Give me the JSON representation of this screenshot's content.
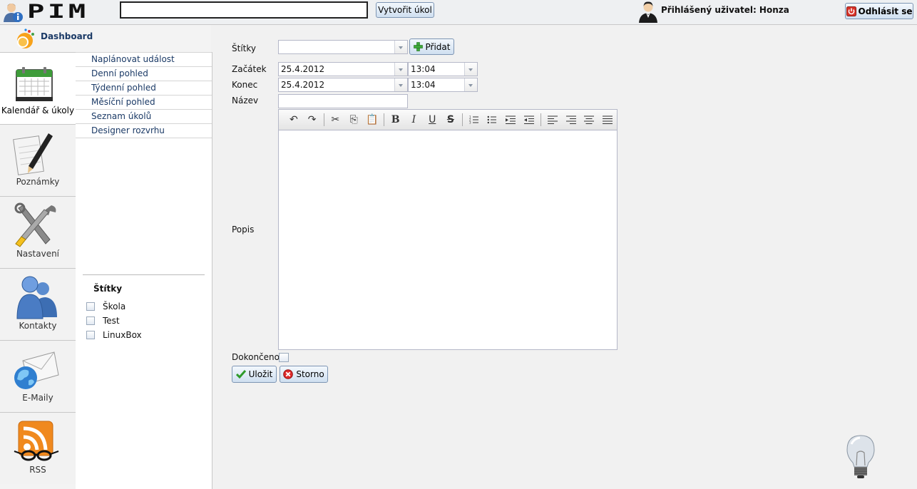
{
  "topbar": {
    "logo_text": "PIM",
    "search": {
      "value": "",
      "placeholder": ""
    },
    "create_task_label": "Vytvořit úkol",
    "user_label": "Přihlášený uživatel: Honza",
    "logout_label": "Odhlásit se"
  },
  "dashboard": {
    "label": "Dashboard"
  },
  "modules": [
    {
      "label": "Kalendář & úkoly",
      "icon": "calendar-icon",
      "active": true
    },
    {
      "label": "Poznámky",
      "icon": "notepad-icon"
    },
    {
      "label": "Nastavení",
      "icon": "tools-icon"
    },
    {
      "label": "Kontakty",
      "icon": "contacts-icon"
    },
    {
      "label": "E-Maily",
      "icon": "email-icon"
    },
    {
      "label": "RSS",
      "icon": "rss-icon"
    }
  ],
  "submenu": {
    "items": [
      "Naplánovat událost",
      "Denní pohled",
      "Týdenní pohled",
      "Měsíční pohled",
      "Seznam úkolů",
      "Designer rozvrhu"
    ],
    "tags_title": "Štítky",
    "tags": [
      "Škola",
      "Test",
      "LinuxBox"
    ]
  },
  "form": {
    "tags_label": "Štítky",
    "tags_value": "",
    "add_label": "Přidat",
    "start_label": "Začátek",
    "start_date": "25.4.2012",
    "start_time": "13:04",
    "end_label": "Konec",
    "end_date": "25.4.2012",
    "end_time": "13:04",
    "name_label": "Název",
    "name_value": "",
    "description_label": "Popis",
    "done_label": "Dokončeno",
    "save_label": "Uložit",
    "cancel_label": "Storno"
  },
  "colors": {
    "link": "#1b3a66",
    "button_border": "#7d95b3",
    "background": "#f1f1f1"
  }
}
